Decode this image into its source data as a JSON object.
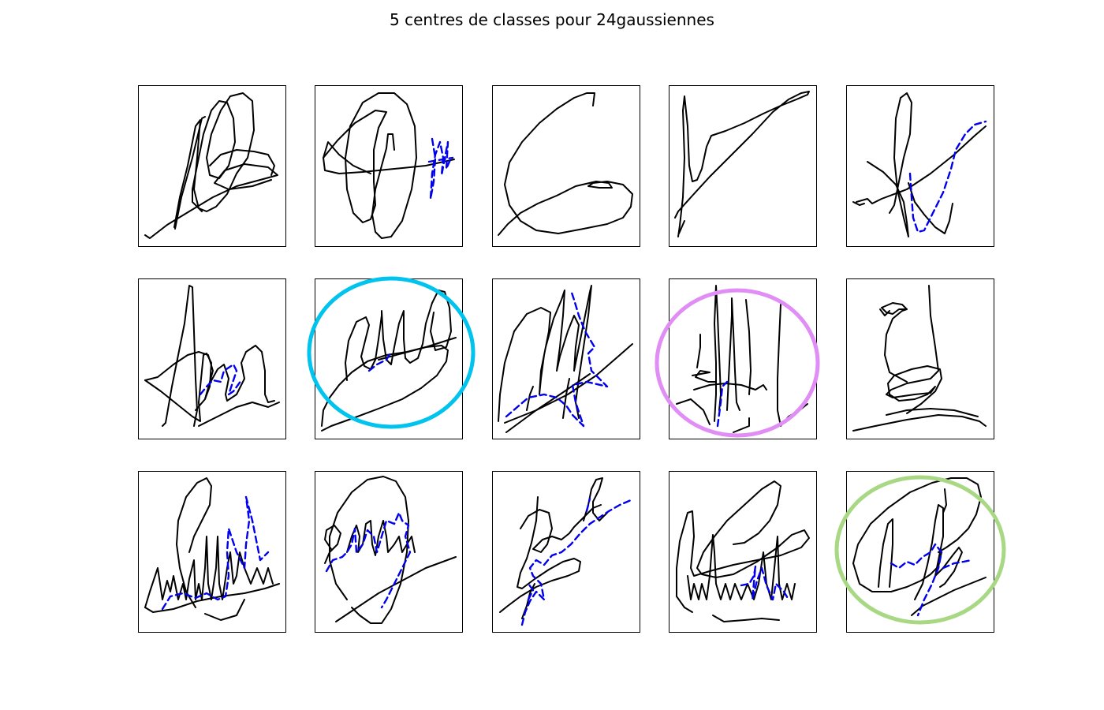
{
  "title": "5 centres de classes pour 24gaussiennes",
  "colors": {
    "background": "#ffffff",
    "signature_stroke": "#000000",
    "dashed_stroke": "#0000ee",
    "highlight_cyan": "#00c3ee",
    "highlight_violet": "#e08ef5",
    "highlight_green": "#a8d884"
  },
  "panels": [
    {
      "row": 1,
      "col": 1,
      "dashed": false,
      "highlight": "none"
    },
    {
      "row": 1,
      "col": 2,
      "dashed": true,
      "highlight": "none"
    },
    {
      "row": 1,
      "col": 3,
      "dashed": false,
      "highlight": "none"
    },
    {
      "row": 1,
      "col": 4,
      "dashed": false,
      "highlight": "none"
    },
    {
      "row": 1,
      "col": 5,
      "dashed": true,
      "highlight": "none"
    },
    {
      "row": 2,
      "col": 1,
      "dashed": true,
      "highlight": "none"
    },
    {
      "row": 2,
      "col": 2,
      "dashed": true,
      "highlight": "cyan"
    },
    {
      "row": 2,
      "col": 3,
      "dashed": true,
      "highlight": "none"
    },
    {
      "row": 2,
      "col": 4,
      "dashed": true,
      "highlight": "violet"
    },
    {
      "row": 2,
      "col": 5,
      "dashed": false,
      "highlight": "none"
    },
    {
      "row": 3,
      "col": 1,
      "dashed": true,
      "highlight": "none"
    },
    {
      "row": 3,
      "col": 2,
      "dashed": true,
      "highlight": "none"
    },
    {
      "row": 3,
      "col": 3,
      "dashed": true,
      "highlight": "none"
    },
    {
      "row": 3,
      "col": 4,
      "dashed": true,
      "highlight": "none"
    },
    {
      "row": 3,
      "col": 5,
      "dashed": true,
      "highlight": "green"
    }
  ]
}
